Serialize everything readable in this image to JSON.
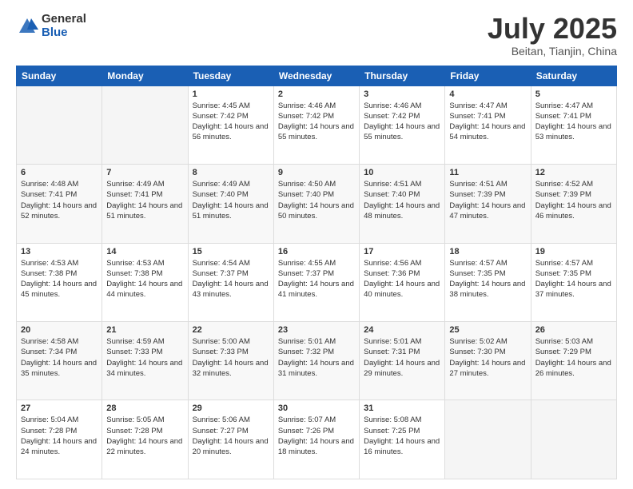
{
  "logo": {
    "general": "General",
    "blue": "Blue"
  },
  "header": {
    "month": "July 2025",
    "location": "Beitan, Tianjin, China"
  },
  "weekdays": [
    "Sunday",
    "Monday",
    "Tuesday",
    "Wednesday",
    "Thursday",
    "Friday",
    "Saturday"
  ],
  "weeks": [
    [
      {
        "day": "",
        "info": ""
      },
      {
        "day": "",
        "info": ""
      },
      {
        "day": "1",
        "info": "Sunrise: 4:45 AM\nSunset: 7:42 PM\nDaylight: 14 hours and 56 minutes."
      },
      {
        "day": "2",
        "info": "Sunrise: 4:46 AM\nSunset: 7:42 PM\nDaylight: 14 hours and 55 minutes."
      },
      {
        "day": "3",
        "info": "Sunrise: 4:46 AM\nSunset: 7:42 PM\nDaylight: 14 hours and 55 minutes."
      },
      {
        "day": "4",
        "info": "Sunrise: 4:47 AM\nSunset: 7:41 PM\nDaylight: 14 hours and 54 minutes."
      },
      {
        "day": "5",
        "info": "Sunrise: 4:47 AM\nSunset: 7:41 PM\nDaylight: 14 hours and 53 minutes."
      }
    ],
    [
      {
        "day": "6",
        "info": "Sunrise: 4:48 AM\nSunset: 7:41 PM\nDaylight: 14 hours and 52 minutes."
      },
      {
        "day": "7",
        "info": "Sunrise: 4:49 AM\nSunset: 7:41 PM\nDaylight: 14 hours and 51 minutes."
      },
      {
        "day": "8",
        "info": "Sunrise: 4:49 AM\nSunset: 7:40 PM\nDaylight: 14 hours and 51 minutes."
      },
      {
        "day": "9",
        "info": "Sunrise: 4:50 AM\nSunset: 7:40 PM\nDaylight: 14 hours and 50 minutes."
      },
      {
        "day": "10",
        "info": "Sunrise: 4:51 AM\nSunset: 7:40 PM\nDaylight: 14 hours and 48 minutes."
      },
      {
        "day": "11",
        "info": "Sunrise: 4:51 AM\nSunset: 7:39 PM\nDaylight: 14 hours and 47 minutes."
      },
      {
        "day": "12",
        "info": "Sunrise: 4:52 AM\nSunset: 7:39 PM\nDaylight: 14 hours and 46 minutes."
      }
    ],
    [
      {
        "day": "13",
        "info": "Sunrise: 4:53 AM\nSunset: 7:38 PM\nDaylight: 14 hours and 45 minutes."
      },
      {
        "day": "14",
        "info": "Sunrise: 4:53 AM\nSunset: 7:38 PM\nDaylight: 14 hours and 44 minutes."
      },
      {
        "day": "15",
        "info": "Sunrise: 4:54 AM\nSunset: 7:37 PM\nDaylight: 14 hours and 43 minutes."
      },
      {
        "day": "16",
        "info": "Sunrise: 4:55 AM\nSunset: 7:37 PM\nDaylight: 14 hours and 41 minutes."
      },
      {
        "day": "17",
        "info": "Sunrise: 4:56 AM\nSunset: 7:36 PM\nDaylight: 14 hours and 40 minutes."
      },
      {
        "day": "18",
        "info": "Sunrise: 4:57 AM\nSunset: 7:35 PM\nDaylight: 14 hours and 38 minutes."
      },
      {
        "day": "19",
        "info": "Sunrise: 4:57 AM\nSunset: 7:35 PM\nDaylight: 14 hours and 37 minutes."
      }
    ],
    [
      {
        "day": "20",
        "info": "Sunrise: 4:58 AM\nSunset: 7:34 PM\nDaylight: 14 hours and 35 minutes."
      },
      {
        "day": "21",
        "info": "Sunrise: 4:59 AM\nSunset: 7:33 PM\nDaylight: 14 hours and 34 minutes."
      },
      {
        "day": "22",
        "info": "Sunrise: 5:00 AM\nSunset: 7:33 PM\nDaylight: 14 hours and 32 minutes."
      },
      {
        "day": "23",
        "info": "Sunrise: 5:01 AM\nSunset: 7:32 PM\nDaylight: 14 hours and 31 minutes."
      },
      {
        "day": "24",
        "info": "Sunrise: 5:01 AM\nSunset: 7:31 PM\nDaylight: 14 hours and 29 minutes."
      },
      {
        "day": "25",
        "info": "Sunrise: 5:02 AM\nSunset: 7:30 PM\nDaylight: 14 hours and 27 minutes."
      },
      {
        "day": "26",
        "info": "Sunrise: 5:03 AM\nSunset: 7:29 PM\nDaylight: 14 hours and 26 minutes."
      }
    ],
    [
      {
        "day": "27",
        "info": "Sunrise: 5:04 AM\nSunset: 7:28 PM\nDaylight: 14 hours and 24 minutes."
      },
      {
        "day": "28",
        "info": "Sunrise: 5:05 AM\nSunset: 7:28 PM\nDaylight: 14 hours and 22 minutes."
      },
      {
        "day": "29",
        "info": "Sunrise: 5:06 AM\nSunset: 7:27 PM\nDaylight: 14 hours and 20 minutes."
      },
      {
        "day": "30",
        "info": "Sunrise: 5:07 AM\nSunset: 7:26 PM\nDaylight: 14 hours and 18 minutes."
      },
      {
        "day": "31",
        "info": "Sunrise: 5:08 AM\nSunset: 7:25 PM\nDaylight: 14 hours and 16 minutes."
      },
      {
        "day": "",
        "info": ""
      },
      {
        "day": "",
        "info": ""
      }
    ]
  ]
}
